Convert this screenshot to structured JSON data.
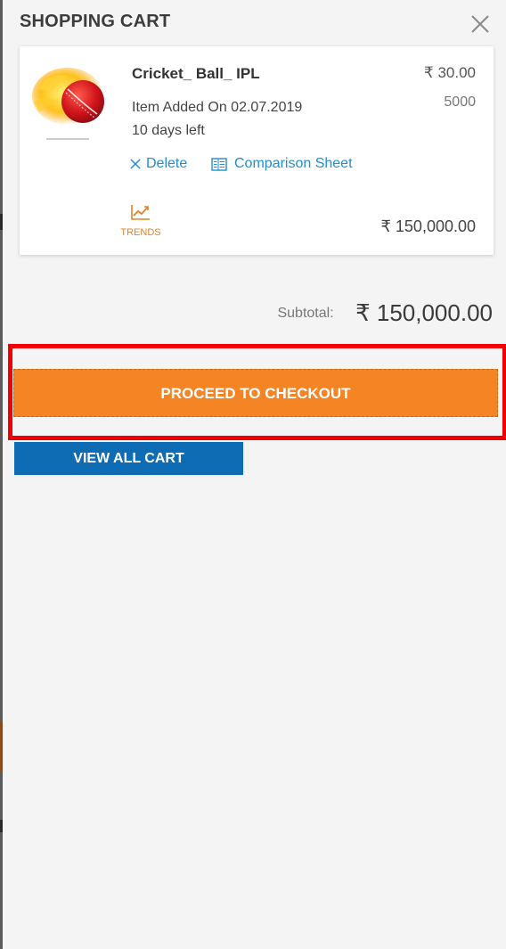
{
  "header": {
    "title": "SHOPPING CART"
  },
  "cart_item": {
    "name": "Cricket_ Ball_ IPL",
    "added_on": "Item Added On 02.07.2019",
    "days_left": "10 days left",
    "unit_price": "₹ 30.00",
    "quantity": "5000",
    "delete_label": "Delete",
    "comparison_label": "Comparison Sheet",
    "trends_label": "TRENDS",
    "line_total": "₹ 150,000.00"
  },
  "summary": {
    "subtotal_label": "Subtotal:",
    "subtotal_value": "₹ 150,000.00"
  },
  "actions": {
    "checkout_label": "PROCEED TO CHECKOUT",
    "view_cart_label": "VIEW ALL CART"
  },
  "icons": {
    "close": "close-icon",
    "delete": "x-icon",
    "comparison": "document-icon",
    "trends": "trend-chart-icon",
    "product": "cricket-ball-image"
  },
  "colors": {
    "accent_orange": "#f58424",
    "primary_blue": "#0e6cb4",
    "link_blue": "#1f8fd1",
    "highlight_red": "#f00000"
  }
}
